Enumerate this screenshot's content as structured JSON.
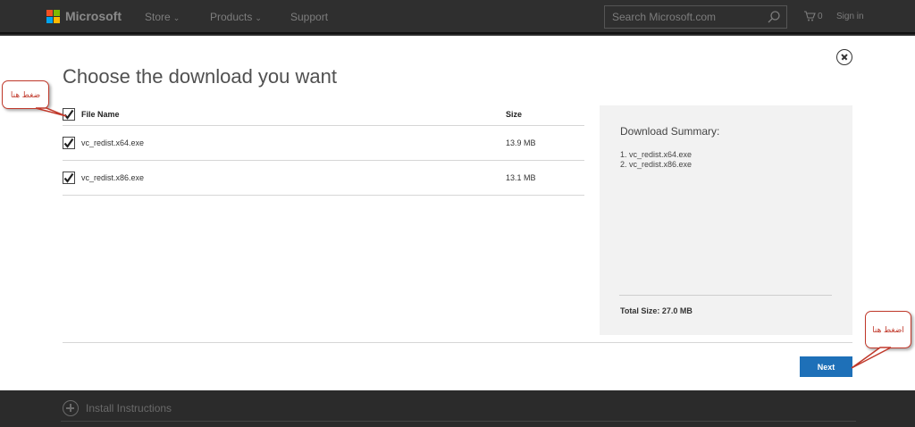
{
  "topbar": {
    "brand": "Microsoft",
    "logo_colors": [
      "#f25022",
      "#7fba00",
      "#00a4ef",
      "#ffb900"
    ],
    "nav": [
      {
        "label": "Store",
        "chevron": "⌄"
      },
      {
        "label": "Products",
        "chevron": "⌄"
      },
      {
        "label": "Support"
      }
    ],
    "search_placeholder": "Search Microsoft.com",
    "cart_count": "0",
    "signin": "Sign in"
  },
  "dialog": {
    "title": "Choose the download you want",
    "columns": {
      "name": "File Name",
      "size": "Size"
    },
    "files": [
      {
        "name": "vc_redist.x64.exe",
        "size": "13.9 MB",
        "checked": true
      },
      {
        "name": "vc_redist.x86.exe",
        "size": "13.1 MB",
        "checked": true
      }
    ],
    "summary": {
      "title": "Download Summary:",
      "items": [
        "1. vc_redist.x64.exe",
        "2. vc_redist.x86.exe"
      ],
      "total": "Total Size: 27.0 MB"
    },
    "next_label": "Next"
  },
  "below": {
    "install_instructions": "Install Instructions"
  },
  "annotations": {
    "callout_1": "ضغط هنا",
    "callout_2": "اضغط هنا",
    "color": "#c0392b"
  }
}
